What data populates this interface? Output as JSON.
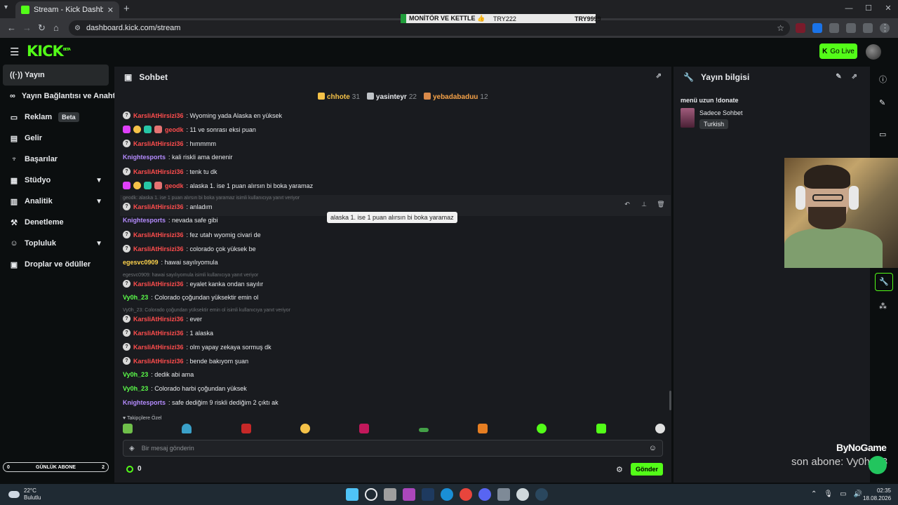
{
  "browser": {
    "tab_title": "Stream - Kick Dashboard",
    "url": "dashboard.kick.com/stream",
    "ticker": [
      "MONİTÖR VE KETTLE 👍",
      "TRY222",
      "TRY9999"
    ]
  },
  "header": {
    "logo": "KICK",
    "logo_sup": "BETA",
    "go_live": "Go Live"
  },
  "sidebar": {
    "items": [
      {
        "label": "Yayın",
        "icon": "broadcast-icon"
      },
      {
        "label": "Yayın Bağlantısı ve Anahtar",
        "icon": "link-icon"
      },
      {
        "label": "Reklam",
        "icon": "ad-icon",
        "badge": "Beta"
      },
      {
        "label": "Gelir",
        "icon": "revenue-icon"
      },
      {
        "label": "Başarılar",
        "icon": "trophy-icon"
      },
      {
        "label": "Stüdyo",
        "icon": "studio-icon"
      },
      {
        "label": "Analitik",
        "icon": "chart-icon"
      },
      {
        "label": "Denetleme",
        "icon": "hammer-icon"
      },
      {
        "label": "Topluluk",
        "icon": "community-icon"
      },
      {
        "label": "Droplar ve ödüller",
        "icon": "gift-icon"
      }
    ],
    "sub_goal": {
      "left": "0",
      "label": "GÜNLÜK ABONE",
      "right": "2"
    }
  },
  "chat": {
    "title": "Sohbet",
    "leaders": [
      {
        "user": "chhote",
        "count": "31"
      },
      {
        "user": "yasinteyr",
        "count": "22"
      },
      {
        "user": "yebadabaduu",
        "count": "12"
      }
    ],
    "messages": [
      {
        "user": "KarsliAtHirsizi36",
        "text": ": Wyoming yada Alaska en yüksek"
      },
      {
        "user": "geodk",
        "text": ": 11 ve sonrası eksi puan"
      },
      {
        "user": "KarsliAtHirsizi36",
        "text": ": hımmmm"
      },
      {
        "user": "Knightesports",
        "text": ": kali riskli ama denenir"
      },
      {
        "user": "KarsliAtHirsizi36",
        "text": ": tenk tu dk"
      },
      {
        "user": "geodk",
        "text": ": alaska 1. ise 1 puan alırsın bi boka yaramaz"
      },
      {
        "user": "KarsliAtHirsizi36",
        "text": ": anladım"
      },
      {
        "user": "Knightesports",
        "text": ": nevada safe gibi"
      },
      {
        "user": "KarsliAtHirsizi36",
        "text": ": fez utah wyomig civari de"
      },
      {
        "user": "KarsliAtHirsizi36",
        "text": ": colorado çok yüksek be"
      },
      {
        "user": "egesvc0909",
        "text": ": hawai sayılıyomula"
      },
      {
        "user": "KarsliAtHirsizi36",
        "text": ": eyalet kanka ondan sayılır"
      },
      {
        "user": "Vy0h_23",
        "text": ": Colorado çoğundan yüksektir emin ol"
      },
      {
        "user": "KarsliAtHirsizi36",
        "text": ": ever"
      },
      {
        "user": "KarsliAtHirsizi36",
        "text": ": 1 alaska"
      },
      {
        "user": "KarsliAtHirsizi36",
        "text": ": olm yapay zekaya sormuş dk"
      },
      {
        "user": "KarsliAtHirsizi36",
        "text": ": bende bakıyom şuan"
      },
      {
        "user": "Vy0h_23",
        "text": ": dedik abi ama"
      },
      {
        "user": "Vy0h_23",
        "text": ": Colorado harbi çoğundan yüksek"
      },
      {
        "user": "Knightesports",
        "text": ": safe dediğim 9 riskli dediğim 2 çıktı ak"
      }
    ],
    "replies": [
      "geodk: alaska 1. ise 1 puan alırsın bi boka yaramaz isimli kullanıcıya yanıt veriyor",
      "egesvc0909: hawai sayılıyomula isimli kullanıcıya yanıt veriyor",
      "Vy0h_23: Colorado çoğundan yüksektir emin ol isimli kullanıcıya yanıt veriyor"
    ],
    "tooltip": "alaska 1. ise 1 puan alırsın bi boka yaramaz",
    "emote_label": "Takipçilere Özel",
    "input_placeholder": "Bir mesaj gönderin",
    "points": "0",
    "send": "Gönder",
    "colors": {
      "red": "#ff4d4d",
      "purple": "#b58cff",
      "green": "#5cff4a",
      "yellow": "#ffd34d"
    }
  },
  "info": {
    "title": "Yayın bilgisi",
    "stream_title": "menü uzun !donate",
    "category": "Sadece Sohbet",
    "language": "Turkish"
  },
  "overlay": {
    "brand": "ByNoGame",
    "last_sub": "son abone: Vy0h_23"
  },
  "taskbar": {
    "temp": "22°C",
    "weather": "Bulutlu",
    "time": "02:35",
    "date": "18.08.2026"
  }
}
